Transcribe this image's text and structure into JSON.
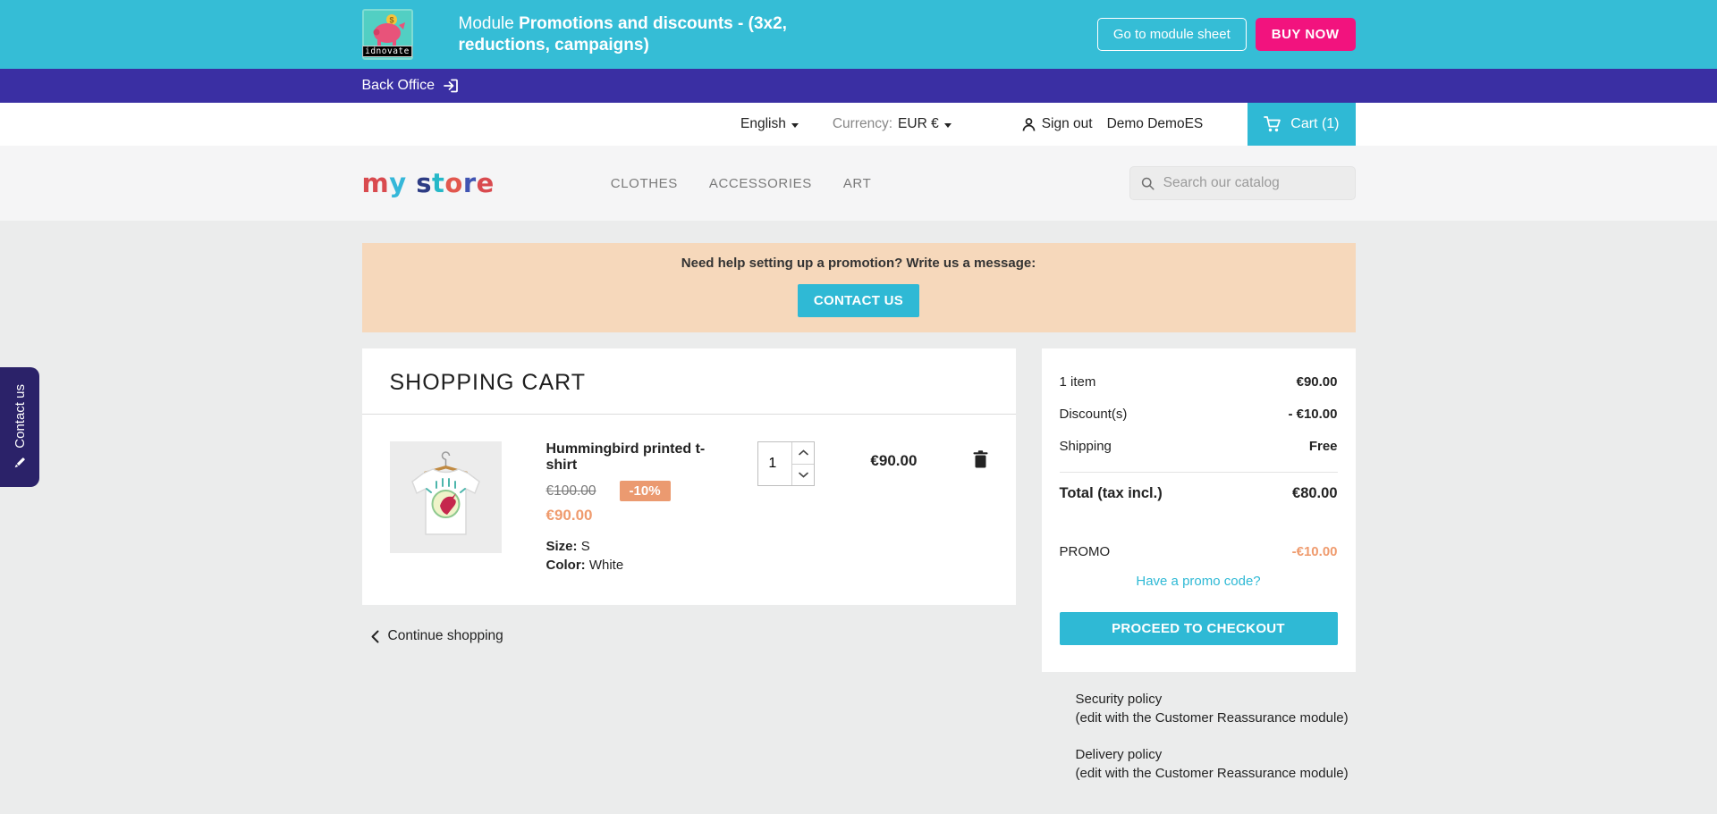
{
  "module_header": {
    "vendor": "idnovate",
    "title_prefix": "Module",
    "title": "Promotions and discounts - (3x2, reductions, campaigns)",
    "module_sheet_button": "Go to module sheet",
    "buy_now_button": "BUY NOW"
  },
  "back_office_bar": {
    "label": "Back Office"
  },
  "top_bar": {
    "language": "English",
    "currency_label": "Currency:",
    "currency_value": "EUR €",
    "sign_out": "Sign out",
    "user_name": "Demo DemoES",
    "cart_label": "Cart (1)"
  },
  "store_header": {
    "logo": "my store",
    "nav": [
      "CLOTHES",
      "ACCESSORIES",
      "ART"
    ],
    "search_placeholder": "Search our catalog"
  },
  "help_banner": {
    "message": "Need help setting up a promotion? Write us a message:",
    "button": "CONTACT US"
  },
  "cart": {
    "title": "SHOPPING CART",
    "item": {
      "name": "Hummingbird printed t-shirt",
      "regular_price": "€100.00",
      "discount_badge": "-10%",
      "discounted_price": "€90.00",
      "size_label": "Size:",
      "size_value": "S",
      "color_label": "Color:",
      "color_value": "White",
      "quantity": "1",
      "line_total": "€90.00"
    },
    "continue_shopping": "Continue shopping"
  },
  "summary": {
    "rows": [
      {
        "label": "1 item",
        "value": "€90.00"
      },
      {
        "label": "Discount(s)",
        "value": "- €10.00"
      },
      {
        "label": "Shipping",
        "value": "Free"
      }
    ],
    "total_label": "Total (tax incl.)",
    "total_value": "€80.00",
    "promo_label": "PROMO",
    "promo_value": "-€10.00",
    "promo_link": "Have a promo code?",
    "checkout_button": "PROCEED TO CHECKOUT"
  },
  "policies": [
    {
      "title": "Security policy",
      "subtitle": "(edit with the Customer Reassurance module)"
    },
    {
      "title": "Delivery policy",
      "subtitle": "(edit with the Customer Reassurance module)"
    }
  ],
  "contact_tab": {
    "label": "Contact us"
  },
  "colors": {
    "header_cyan": "#35bdd6",
    "buy_now_pink": "#f2137e",
    "back_office_purple": "#3a2fa3",
    "accent_cyan": "#2fb9d5",
    "promo_orange": "#ef9b6e",
    "banner_peach": "#f6d8bb",
    "contact_tab_navy": "#2b2269"
  }
}
